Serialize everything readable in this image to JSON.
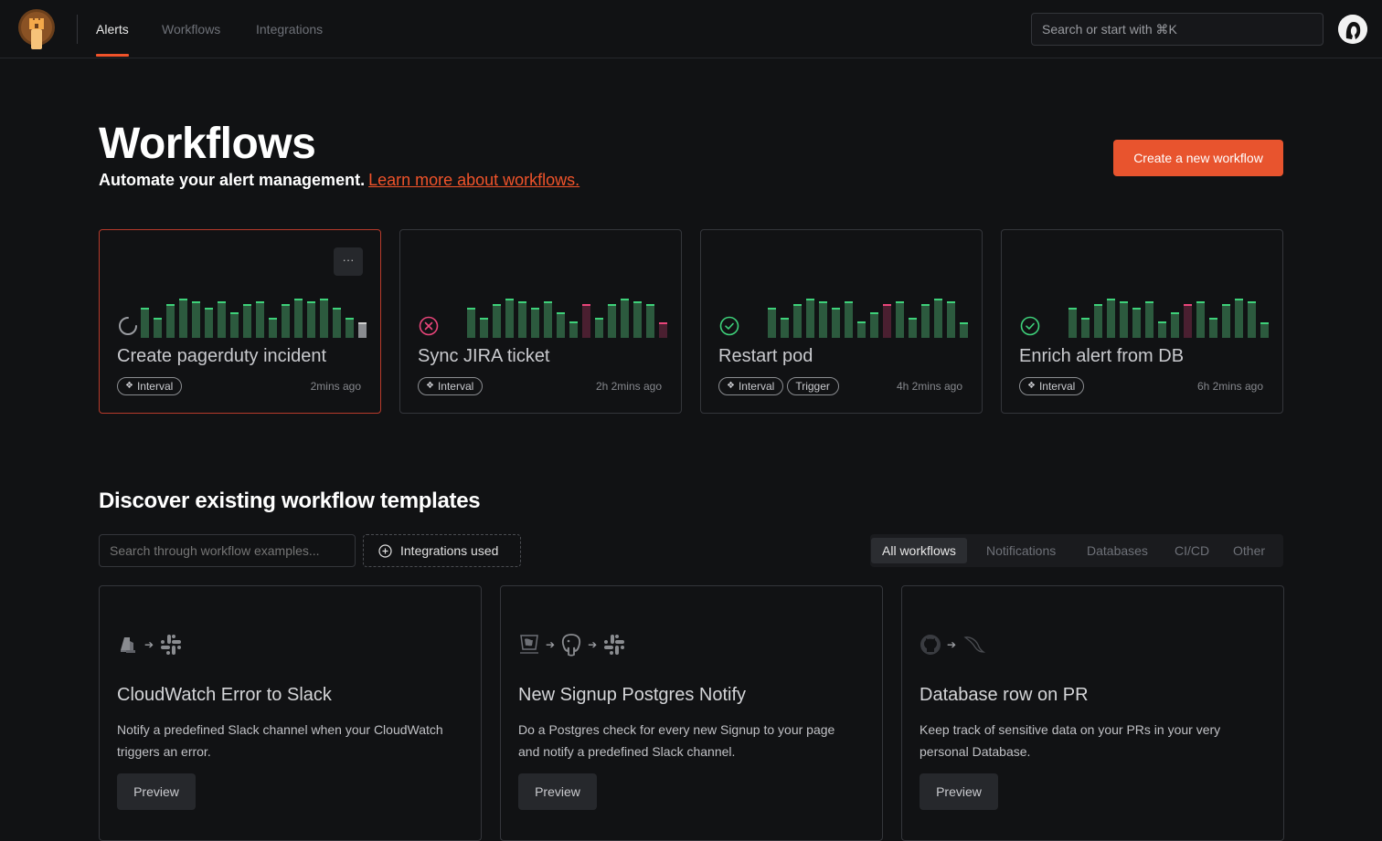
{
  "nav": {
    "tabs": [
      {
        "label": "Alerts",
        "active": true
      },
      {
        "label": "Workflows",
        "active": false
      },
      {
        "label": "Integrations",
        "active": false
      }
    ],
    "search_placeholder": "Search or start with ⌘K"
  },
  "header": {
    "title": "Workflows",
    "subtitle": "Automate your alert management.",
    "learn_more": "Learn more about workflows.",
    "create_button": "Create a new workflow"
  },
  "workflows": [
    {
      "name": "Create pagerduty incident",
      "status": "running",
      "tags": [
        "Interval"
      ],
      "time": "2mins ago",
      "bars": [
        "ok",
        "ok",
        "ok",
        "ok",
        "ok",
        "ok",
        "ok",
        "ok",
        "ok",
        "ok",
        "ok",
        "ok",
        "ok",
        "ok",
        "ok",
        "ok",
        "ok",
        "pending"
      ],
      "levels": [
        0.72,
        0.48,
        0.8,
        0.94,
        0.86,
        0.72,
        0.86,
        0.6,
        0.8,
        0.86,
        0.48,
        0.8,
        0.94,
        0.86,
        0.94,
        0.72,
        0.48,
        0.38
      ]
    },
    {
      "name": "Sync JIRA ticket",
      "status": "failed",
      "tags": [
        "Interval"
      ],
      "time": "2h 2mins ago",
      "bars": [
        "ok",
        "ok",
        "ok",
        "ok",
        "ok",
        "ok",
        "ok",
        "ok",
        "ok",
        "fail",
        "ok",
        "ok",
        "ok",
        "ok",
        "ok",
        "fail"
      ],
      "levels": [
        0.72,
        0.48,
        0.8,
        0.94,
        0.86,
        0.72,
        0.86,
        0.6,
        0.4,
        0.8,
        0.48,
        0.8,
        0.94,
        0.86,
        0.8,
        0.38
      ]
    },
    {
      "name": "Restart pod",
      "status": "success",
      "tags": [
        "Interval",
        "Trigger"
      ],
      "time": "4h 2mins ago",
      "bars": [
        "ok",
        "ok",
        "ok",
        "ok",
        "ok",
        "ok",
        "ok",
        "ok",
        "ok",
        "fail",
        "ok",
        "ok",
        "ok",
        "ok",
        "ok",
        "ok"
      ],
      "levels": [
        0.72,
        0.48,
        0.8,
        0.94,
        0.86,
        0.72,
        0.86,
        0.4,
        0.6,
        0.8,
        0.86,
        0.48,
        0.8,
        0.94,
        0.86,
        0.38
      ]
    },
    {
      "name": "Enrich alert from DB",
      "status": "success",
      "tags": [
        "Interval"
      ],
      "time": "6h 2mins ago",
      "bars": [
        "ok",
        "ok",
        "ok",
        "ok",
        "ok",
        "ok",
        "ok",
        "ok",
        "ok",
        "fail",
        "ok",
        "ok",
        "ok",
        "ok",
        "ok",
        "ok"
      ],
      "levels": [
        0.72,
        0.48,
        0.8,
        0.94,
        0.86,
        0.72,
        0.86,
        0.4,
        0.6,
        0.8,
        0.86,
        0.48,
        0.8,
        0.94,
        0.86,
        0.38
      ]
    }
  ],
  "templates_section": {
    "title": "Discover existing workflow templates",
    "search_placeholder": "Search through workflow examples...",
    "integrations_button": "Integrations used",
    "filters": [
      {
        "label": "All workflows",
        "active": true
      },
      {
        "label": "Notifications",
        "active": false
      },
      {
        "label": "Databases",
        "active": false
      },
      {
        "label": "CI/CD",
        "active": false
      },
      {
        "label": "Other",
        "active": false
      }
    ]
  },
  "templates": [
    {
      "name": "CloudWatch Error to Slack",
      "description": "Notify a predefined Slack channel when your CloudWatch triggers an error.",
      "icons": [
        "cloudwatch-icon",
        "slack-icon"
      ],
      "preview": "Preview"
    },
    {
      "name": "New Signup Postgres Notify",
      "description": "Do a Postgres check for every new Signup to your page and notify a predefined Slack channel.",
      "icons": [
        "datadog-icon",
        "postgres-icon",
        "slack-icon"
      ],
      "preview": "Preview"
    },
    {
      "name": "Database row on PR",
      "description": "Keep track of sensitive data on your PRs in your very personal Database.",
      "icons": [
        "github-icon",
        "mysql-icon"
      ],
      "preview": "Preview"
    }
  ],
  "colors": {
    "accent": "#e8542e",
    "success": "#3ed17a",
    "fail": "#e9457a",
    "bar_ok": "#2c5a3e"
  }
}
